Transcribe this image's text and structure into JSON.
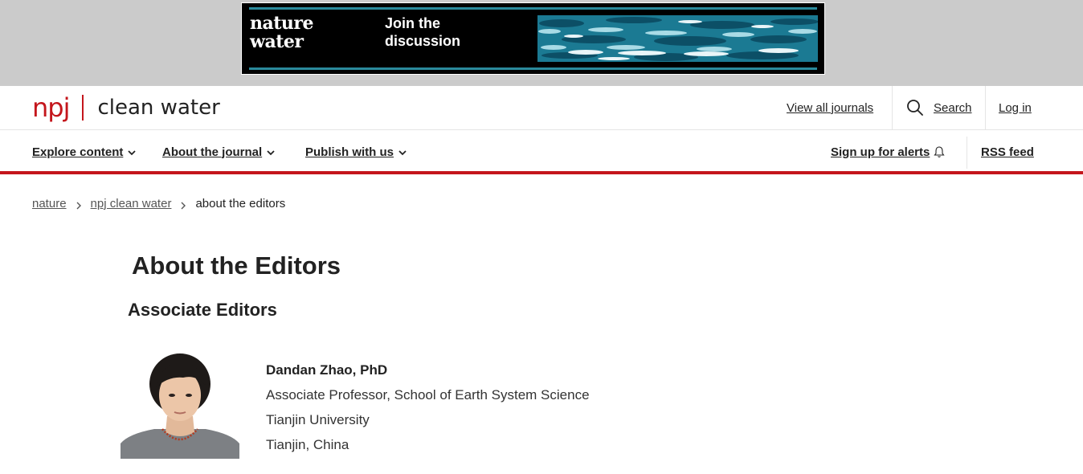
{
  "ad": {
    "brand_line1": "nature",
    "brand_line2": "water",
    "cta_line1": "Join the",
    "cta_line2": "discussion",
    "accent_color": "#2a8a9c"
  },
  "header": {
    "logo_prefix": "npj",
    "logo_title": "clean water",
    "view_all_journals": "View all journals",
    "search": "Search",
    "login": "Log in",
    "brand_color": "#c4161c",
    "icons": {
      "search": "search-icon"
    }
  },
  "nav": {
    "items": [
      {
        "label": "Explore content"
      },
      {
        "label": "About the journal"
      },
      {
        "label": "Publish with us"
      }
    ],
    "alerts": "Sign up for alerts",
    "rss": "RSS feed",
    "icons": {
      "dropdown": "chevron-down-icon",
      "alerts": "bell-icon"
    }
  },
  "breadcrumb": {
    "items": [
      "nature",
      "npj clean water",
      "about the editors"
    ]
  },
  "main": {
    "title": "About the Editors",
    "section_title": "Associate Editors",
    "editors": [
      {
        "name": "Dandan Zhao, PhD",
        "role": "Associate Professor, School of Earth System Science",
        "institution": "Tianjin University",
        "location": "Tianjin, China"
      }
    ]
  }
}
